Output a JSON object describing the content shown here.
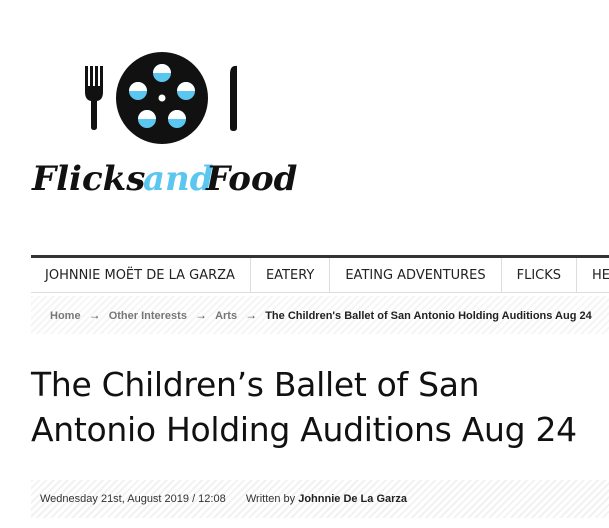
{
  "site": {
    "logo_word_1": "Flicks",
    "logo_word_2": "and",
    "logo_word_3": "Food"
  },
  "colors": {
    "accent": "#5bc6f0",
    "dark": "#111111"
  },
  "nav": {
    "items": [
      "JOHNNIE MOËT DE LA GARZA",
      "EATERY",
      "EATING ADVENTURES",
      "FLICKS",
      "HEALTH"
    ]
  },
  "breadcrumb": {
    "items": [
      "Home",
      "Other Interests",
      "Arts"
    ],
    "separator": "→",
    "current": "The Children's Ballet of San Antonio Holding Auditions Aug 24"
  },
  "article": {
    "title": "The Children’s Ballet of San Antonio Holding Auditions Aug 24",
    "date": "Wednesday 21st, August 2019 / 12:08",
    "written_by": "Written by",
    "author": "Johnnie De La Garza"
  }
}
